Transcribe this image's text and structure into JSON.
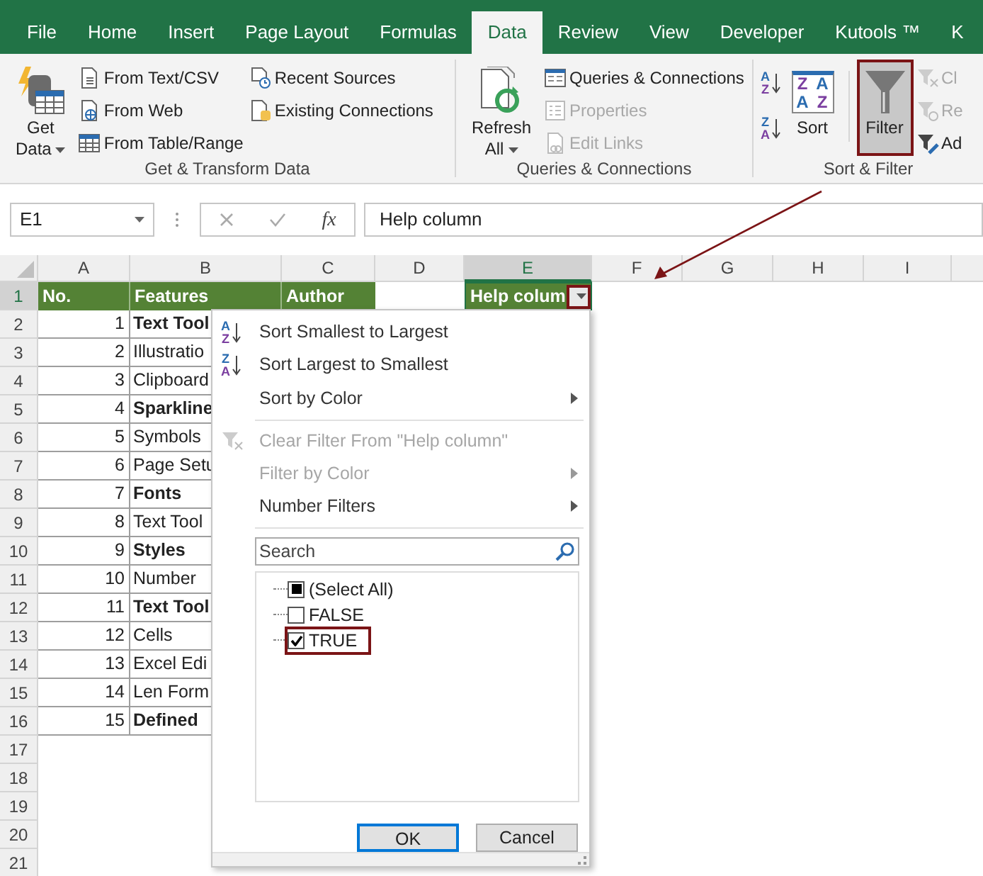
{
  "tabs": [
    {
      "label": "File",
      "selected": false
    },
    {
      "label": "Home",
      "selected": false
    },
    {
      "label": "Insert",
      "selected": false
    },
    {
      "label": "Page Layout",
      "selected": false
    },
    {
      "label": "Formulas",
      "selected": false
    },
    {
      "label": "Data",
      "selected": true
    },
    {
      "label": "Review",
      "selected": false
    },
    {
      "label": "View",
      "selected": false
    },
    {
      "label": "Developer",
      "selected": false
    },
    {
      "label": "Kutools ™",
      "selected": false
    },
    {
      "label": "K",
      "selected": false
    }
  ],
  "ribbon": {
    "groups": [
      {
        "label": "Get & Transform Data",
        "blocks": [
          {
            "kind": "get-data",
            "lines": [
              "Get",
              "Data"
            ],
            "caret": true,
            "on": false,
            "highlighted": false
          },
          {
            "kind": "stack",
            "items": [
              {
                "kind": "text-csv",
                "label": "From Text/CSV",
                "disabled": false
              },
              {
                "kind": "web",
                "label": "From Web",
                "disabled": false
              },
              {
                "kind": "table",
                "label": "From Table/Range",
                "disabled": false
              }
            ]
          },
          {
            "kind": "stack",
            "items": [
              {
                "kind": "recent",
                "label": "Recent Sources",
                "disabled": false
              },
              {
                "kind": "existing",
                "label": "Existing Connections",
                "disabled": false
              }
            ]
          }
        ]
      },
      {
        "label": "Queries & Connections",
        "blocks": [
          {
            "kind": "refresh",
            "lines": [
              "Refresh",
              "All"
            ],
            "caret": true,
            "on": false,
            "highlighted": false
          },
          {
            "kind": "stack",
            "items": [
              {
                "kind": "queries",
                "label": "Queries & Connections",
                "disabled": false
              },
              {
                "kind": "properties",
                "label": "Properties",
                "disabled": true
              },
              {
                "kind": "edit-links",
                "label": "Edit Links",
                "disabled": true
              }
            ]
          }
        ]
      },
      {
        "label": "Sort & Filter",
        "blocks": [
          {
            "kind": "sort-stack",
            "items": [
              {
                "kind": "sort-ascending",
                "letters": [
                  "A",
                  "Z"
                ]
              },
              {
                "kind": "sort-descending",
                "letters": [
                  "Z",
                  "A"
                ]
              }
            ]
          },
          {
            "kind": "sort",
            "lines": [
              "Sort"
            ],
            "tiles": [
              "Z",
              "A",
              "A",
              "Z"
            ],
            "caret": false,
            "on": false,
            "highlighted": false
          },
          {
            "kind": "separator"
          },
          {
            "kind": "filter",
            "lines": [
              "Filter"
            ],
            "caret": false,
            "on": true,
            "highlighted": true
          },
          {
            "kind": "stack",
            "items": [
              {
                "kind": "clear",
                "label": "Cl",
                "disabled": true
              },
              {
                "kind": "reapply",
                "label": "Re",
                "disabled": true
              },
              {
                "kind": "advanced",
                "label": "Ad",
                "disabled": false
              }
            ]
          }
        ]
      }
    ]
  },
  "formula_bar": {
    "name_box": "E1",
    "function_label": "fx",
    "formula": "Help column"
  },
  "sheet": {
    "columns": [
      {
        "label": "A",
        "selected": false
      },
      {
        "label": "B",
        "selected": false
      },
      {
        "label": "C",
        "selected": false
      },
      {
        "label": "D",
        "selected": false
      },
      {
        "label": "E",
        "selected": true
      },
      {
        "label": "F",
        "selected": false
      },
      {
        "label": "G",
        "selected": false
      },
      {
        "label": "H",
        "selected": false
      },
      {
        "label": "I",
        "selected": false
      }
    ],
    "rows": [
      {
        "header": "1",
        "selected": true,
        "kind": "title",
        "a": "No.",
        "b": "Features",
        "c": "Author",
        "e": "Help colum",
        "filter_highlighted": true
      },
      {
        "header": "2",
        "selected": false,
        "kind": "data",
        "a": "1",
        "b": "Text Tool",
        "bold": true
      },
      {
        "header": "3",
        "selected": false,
        "kind": "data",
        "a": "2",
        "b": "Illustratio",
        "bold": false
      },
      {
        "header": "4",
        "selected": false,
        "kind": "data",
        "a": "3",
        "b": "Clipboard",
        "bold": false
      },
      {
        "header": "5",
        "selected": false,
        "kind": "data",
        "a": "4",
        "b": "Sparkline",
        "bold": true
      },
      {
        "header": "6",
        "selected": false,
        "kind": "data",
        "a": "5",
        "b": "Symbols",
        "bold": false
      },
      {
        "header": "7",
        "selected": false,
        "kind": "data",
        "a": "6",
        "b": "Page Setu",
        "bold": false
      },
      {
        "header": "8",
        "selected": false,
        "kind": "data",
        "a": "7",
        "b": "Fonts",
        "bold": true
      },
      {
        "header": "9",
        "selected": false,
        "kind": "data",
        "a": "8",
        "b": "Text Tool",
        "bold": false
      },
      {
        "header": "10",
        "selected": false,
        "kind": "data",
        "a": "9",
        "b": "Styles",
        "bold": true
      },
      {
        "header": "11",
        "selected": false,
        "kind": "data",
        "a": "10",
        "b": "Number",
        "bold": false
      },
      {
        "header": "12",
        "selected": false,
        "kind": "data",
        "a": "11",
        "b": "Text Tool",
        "bold": true
      },
      {
        "header": "13",
        "selected": false,
        "kind": "data",
        "a": "12",
        "b": "Cells",
        "bold": false
      },
      {
        "header": "14",
        "selected": false,
        "kind": "data",
        "a": "13",
        "b": "Excel Edi",
        "bold": false
      },
      {
        "header": "15",
        "selected": false,
        "kind": "data",
        "a": "14",
        "b": "Len Form",
        "bold": false
      },
      {
        "header": "16",
        "selected": false,
        "kind": "data",
        "a": "15",
        "b": "Defined",
        "bold": true
      },
      {
        "header": "17",
        "selected": false,
        "kind": "empty"
      },
      {
        "header": "18",
        "selected": false,
        "kind": "empty"
      },
      {
        "header": "19",
        "selected": false,
        "kind": "empty"
      },
      {
        "header": "20",
        "selected": false,
        "kind": "empty"
      },
      {
        "header": "21",
        "selected": false,
        "kind": "empty"
      }
    ]
  },
  "filter_menu": {
    "items": [
      {
        "kind": "sort-ascending",
        "letters": [
          "A",
          "Z"
        ],
        "label": "Sort Smallest to Largest",
        "disabled": false,
        "submenu": false
      },
      {
        "kind": "sort-descending",
        "letters": [
          "Z",
          "A"
        ],
        "label": "Sort Largest to Smallest",
        "disabled": false,
        "submenu": false
      },
      {
        "kind": "plain",
        "label": "Sort by Color",
        "disabled": false,
        "submenu": true
      },
      {
        "kind": "separator"
      },
      {
        "kind": "clear-filter",
        "label": "Clear Filter From \"Help column\"",
        "disabled": true,
        "submenu": false
      },
      {
        "kind": "plain",
        "label": "Filter by Color",
        "disabled": true,
        "submenu": true
      },
      {
        "kind": "plain",
        "label": "Number Filters",
        "disabled": false,
        "submenu": true
      },
      {
        "kind": "separator"
      }
    ],
    "search": {
      "placeholder": "Search"
    },
    "values": [
      {
        "label": "(Select All)",
        "checked": false,
        "partial": true,
        "highlighted": false
      },
      {
        "label": "FALSE",
        "checked": false,
        "partial": false,
        "highlighted": false
      },
      {
        "label": "TRUE",
        "checked": true,
        "partial": false,
        "highlighted": true
      }
    ],
    "buttons": [
      {
        "label": "OK",
        "default": true
      },
      {
        "label": "Cancel",
        "default": false
      }
    ]
  }
}
